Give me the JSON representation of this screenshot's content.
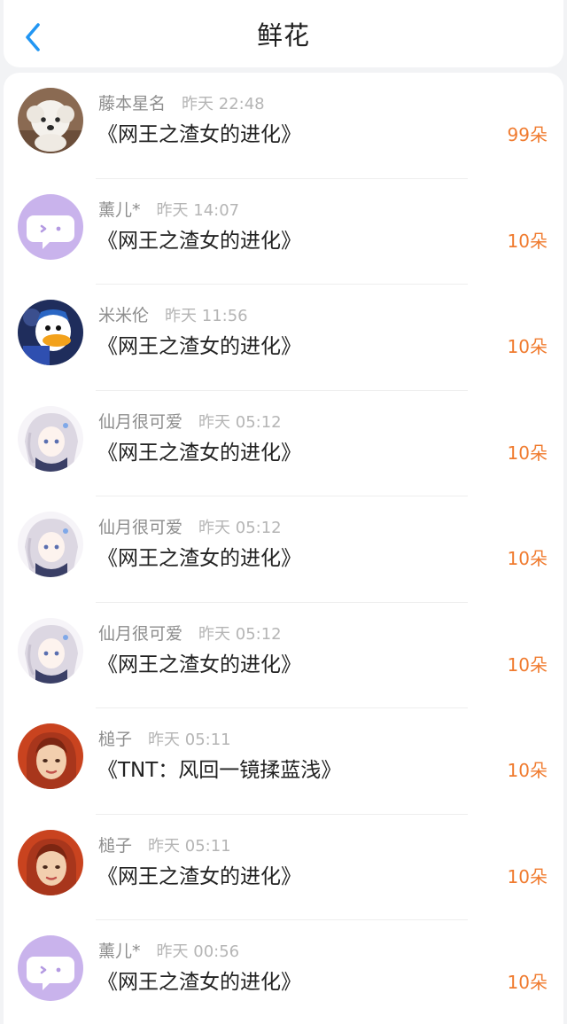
{
  "header": {
    "title": "鲜花"
  },
  "colors": {
    "accent": "#2196f3",
    "count": "#f07b2f",
    "name": "#8d8d8d",
    "time": "#b5b5b5"
  },
  "rows": [
    {
      "name": "藤本星名",
      "time": "昨天 22:48",
      "book": "《网王之渣女的进化》",
      "count": "99朵",
      "avatar": "white-puppy"
    },
    {
      "name": "薰儿*",
      "time": "昨天 14:07",
      "book": "《网王之渣女的进化》",
      "count": "10朵",
      "avatar": "purple-chat-bubble"
    },
    {
      "name": "米米伦",
      "time": "昨天 11:56",
      "book": "《网王之渣女的进化》",
      "count": "10朵",
      "avatar": "cartoon-duck"
    },
    {
      "name": "仙月很可爱",
      "time": "昨天 05:12",
      "book": "《网王之渣女的进化》",
      "count": "10朵",
      "avatar": "anime-girl"
    },
    {
      "name": "仙月很可爱",
      "time": "昨天 05:12",
      "book": "《网王之渣女的进化》",
      "count": "10朵",
      "avatar": "anime-girl"
    },
    {
      "name": "仙月很可爱",
      "time": "昨天 05:12",
      "book": "《网王之渣女的进化》",
      "count": "10朵",
      "avatar": "anime-girl"
    },
    {
      "name": "槌子",
      "time": "昨天 05:11",
      "book": "《TNT：风回一镜揉蓝浅》",
      "count": "10朵",
      "avatar": "painted-portrait"
    },
    {
      "name": "槌子",
      "time": "昨天 05:11",
      "book": "《网王之渣女的进化》",
      "count": "10朵",
      "avatar": "painted-portrait"
    },
    {
      "name": "薰儿*",
      "time": "昨天 00:56",
      "book": "《网王之渣女的进化》",
      "count": "10朵",
      "avatar": "purple-chat-bubble"
    }
  ]
}
